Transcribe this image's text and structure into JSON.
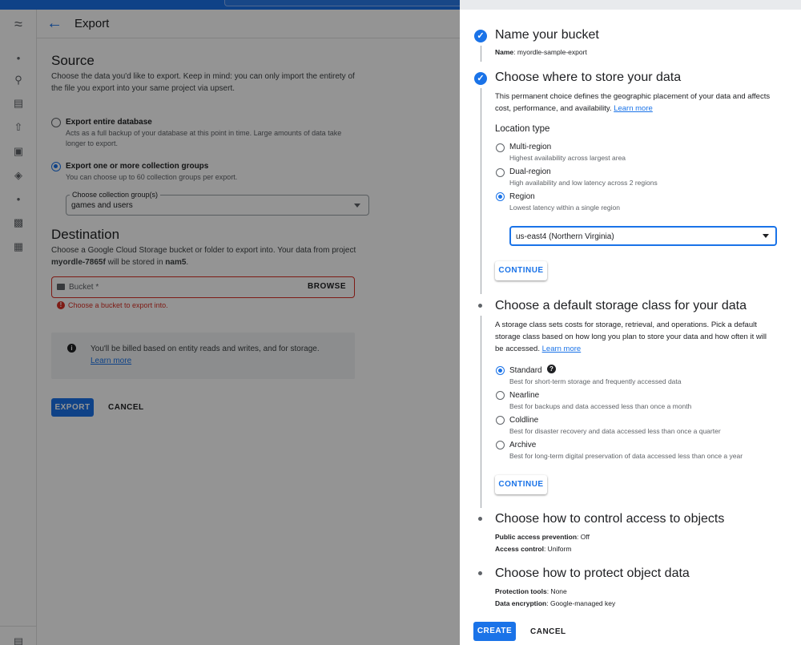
{
  "console": {
    "page_title": "Export",
    "source": {
      "heading": "Source",
      "description": "Choose the data you'd like to export. Keep in mind: you can only import the entirety of the file you export into your same project via upsert.",
      "option_entire": {
        "title": "Export entire database",
        "desc": "Acts as a full backup of your database at this point in time. Large amounts of data take longer to export."
      },
      "option_groups": {
        "title": "Export one or more collection groups",
        "desc": "You can choose up to 60 collection groups per export."
      },
      "collection_select_label": "Choose collection group(s)",
      "collection_select_value": "games and users"
    },
    "destination": {
      "heading": "Destination",
      "description_part1": "Choose a Google Cloud Storage bucket or folder to export into. Your data from project",
      "project": "myordle-7865f",
      "description_part2": "will be stored in",
      "location": "nam5",
      "bucket_label": "Bucket *",
      "browse_label": "BROWSE",
      "error_text": "Choose a bucket to export into."
    },
    "info": {
      "text": "You'll be billed based on entity reads and writes, and for storage.",
      "link": "Learn more"
    },
    "export_button": "EXPORT",
    "cancel_button": "CANCEL"
  },
  "panel": {
    "step1": {
      "title": "Name your bucket",
      "name_label": "Name",
      "name_value": "myordle-sample-export"
    },
    "step2": {
      "title": "Choose where to store your data",
      "description": "This permanent choice defines the geographic placement of your data and affects cost, performance, and availability.",
      "link": "Learn more",
      "location_type_heading": "Location type",
      "options": [
        {
          "title": "Multi-region",
          "desc": "Highest availability across largest area"
        },
        {
          "title": "Dual-region",
          "desc": "High availability and low latency across 2 regions"
        },
        {
          "title": "Region",
          "desc": "Lowest latency within a single region"
        }
      ],
      "selected_option": "Region",
      "region_value": "us-east4 (Northern Virginia)",
      "continue": "CONTINUE"
    },
    "step3": {
      "title": "Choose a default storage class for your data",
      "description": "A storage class sets costs for storage, retrieval, and operations. Pick a default storage class based on how long you plan to store your data and how often it will be accessed.",
      "link": "Learn more",
      "options": [
        {
          "title": "Standard",
          "desc": "Best for short-term storage and frequently accessed data"
        },
        {
          "title": "Nearline",
          "desc": "Best for backups and data accessed less than once a month"
        },
        {
          "title": "Coldline",
          "desc": "Best for disaster recovery and data accessed less than once a quarter"
        },
        {
          "title": "Archive",
          "desc": "Best for long-term digital preservation of data accessed less than once a year"
        }
      ],
      "selected_option": "Standard",
      "continue": "CONTINUE"
    },
    "step4": {
      "title": "Choose how to control access to objects",
      "line1_label": "Public access prevention",
      "line1_value": ": Off",
      "line2_label": "Access control",
      "line2_value": ": Uniform"
    },
    "step5": {
      "title": "Choose how to protect object data",
      "line1_label": "Protection tools",
      "line1_value": ": None",
      "line2_label": "Data encryption",
      "line2_value": ": Google-managed key"
    },
    "create_button": "CREATE",
    "cancel_button": "CANCEL"
  },
  "colors": {
    "accent": "#1a73e8",
    "error": "#d93025",
    "overlay": "rgba(0,0,0,0.42)"
  },
  "icons": [
    "back-arrow-icon",
    "check-icon",
    "info-icon",
    "error-icon",
    "help-icon",
    "folder-icon",
    "chevron-down-icon"
  ]
}
